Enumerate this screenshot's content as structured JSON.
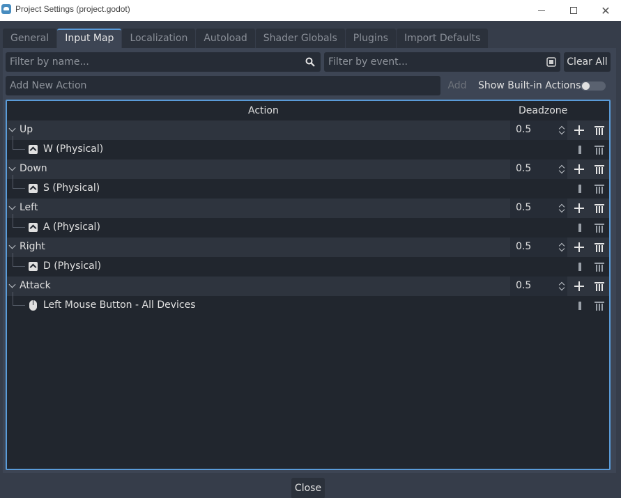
{
  "window": {
    "title": "Project Settings (project.godot)",
    "icon": "godot-icon"
  },
  "tabs": [
    {
      "label": "General"
    },
    {
      "label": "Input Map",
      "active": true
    },
    {
      "label": "Localization"
    },
    {
      "label": "Autoload"
    },
    {
      "label": "Shader Globals"
    },
    {
      "label": "Plugins"
    },
    {
      "label": "Import Defaults"
    }
  ],
  "filters": {
    "name_placeholder": "Filter by name...",
    "event_placeholder": "Filter by event...",
    "clear_all_label": "Clear All"
  },
  "add_action": {
    "placeholder": "Add New Action",
    "add_label": "Add",
    "builtin_label": "Show Built-in Actions",
    "builtin_enabled": false
  },
  "table": {
    "headers": {
      "action": "Action",
      "deadzone": "Deadzone"
    },
    "actions": [
      {
        "name": "Up",
        "deadzone": "0.5",
        "event": "W (Physical)",
        "event_icon": "keyboard-icon"
      },
      {
        "name": "Down",
        "deadzone": "0.5",
        "event": "S (Physical)",
        "event_icon": "keyboard-icon"
      },
      {
        "name": "Left",
        "deadzone": "0.5",
        "event": "A (Physical)",
        "event_icon": "keyboard-icon"
      },
      {
        "name": "Right",
        "deadzone": "0.5",
        "event": "D (Physical)",
        "event_icon": "keyboard-icon"
      },
      {
        "name": "Attack",
        "deadzone": "0.5",
        "event": "Left Mouse Button - All Devices",
        "event_icon": "mouse-icon"
      }
    ]
  },
  "footer": {
    "close_label": "Close"
  },
  "colors": {
    "accent": "#5a9bd8",
    "background": "#363d4a",
    "panel": "#3d4554",
    "tree": "#21262e"
  }
}
